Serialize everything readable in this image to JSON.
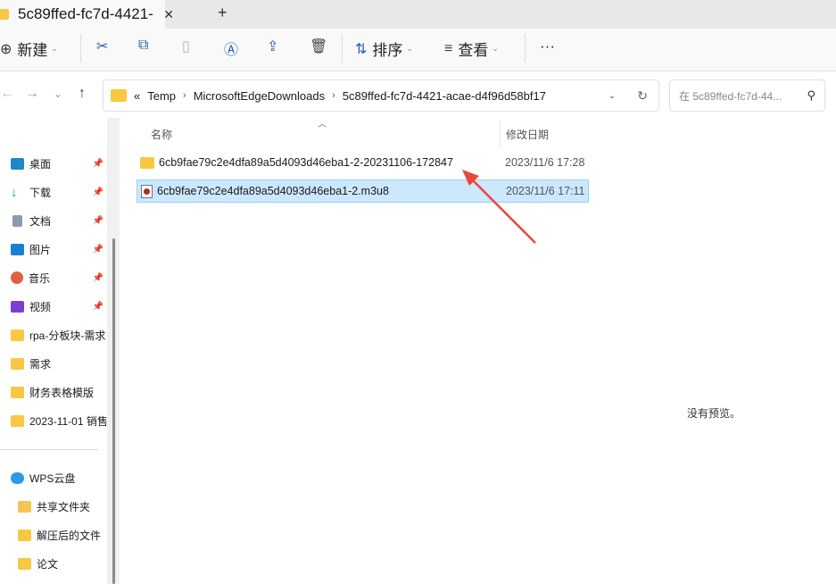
{
  "tab": {
    "title": "5c89ffed-fc7d-4421-",
    "close": "✕",
    "new": "+"
  },
  "toolbar": {
    "new": "新建",
    "sort": "排序",
    "view": "查看",
    "more": "···"
  },
  "nav": {
    "back": "←",
    "forward": "→",
    "recent": "⌄",
    "up": "↑"
  },
  "address": {
    "overflow": "«",
    "crumbs": [
      "Temp",
      "MicrosoftEdgeDownloads",
      "5c89ffed-fc7d-4421-acae-d4f96d58bf17"
    ],
    "sep": "›"
  },
  "search": {
    "placeholder": "在 5c89ffed-fc7d-44..."
  },
  "sidebar": {
    "items": [
      {
        "label": "桌面",
        "color": "#1e88c8"
      },
      {
        "label": "下载",
        "color": "#1aa36f"
      },
      {
        "label": "文档",
        "color": "#8a9ab0"
      },
      {
        "label": "图片",
        "color": "#1a7fd4"
      },
      {
        "label": "音乐",
        "color": "#e06040"
      },
      {
        "label": "视频",
        "color": "#7a3fd0"
      },
      {
        "label": "rpa-分板块-需求",
        "color": "#f8c842"
      },
      {
        "label": "需求",
        "color": "#f8c842"
      },
      {
        "label": "财务表格模版",
        "color": "#f8c842"
      },
      {
        "label": "2023-11-01 销售",
        "color": "#f8c842"
      }
    ],
    "cloud": "WPS云盘",
    "sub": [
      "共享文件夹",
      "解压后的文件",
      "论文"
    ]
  },
  "columns": {
    "name": "名称",
    "date": "修改日期"
  },
  "files": [
    {
      "name": "6cb9fae79c2e4dfa89a5d4093d46eba1-2-20231106-172847",
      "date": "2023/11/6 17:28",
      "type": "folder"
    },
    {
      "name": "6cb9fae79c2e4dfa89a5d4093d46eba1-2.m3u8",
      "date": "2023/11/6 17:11",
      "type": "m3u8"
    }
  ],
  "preview": {
    "message": "没有预览。"
  }
}
